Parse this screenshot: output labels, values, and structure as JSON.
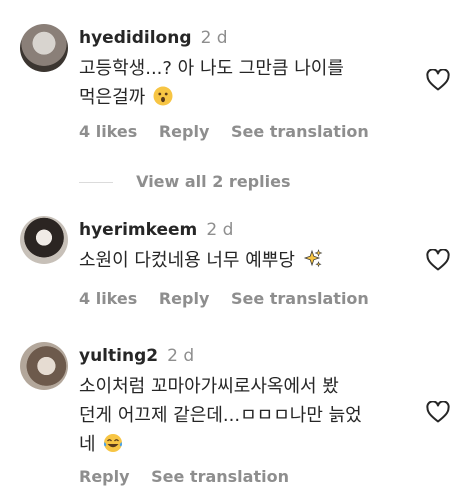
{
  "comments": [
    {
      "username": "hyedidilong",
      "time": "2 d",
      "text_line1": "고등학생...? 아 나도 그만큼 나이를",
      "text_line2": "먹은걸까",
      "likes": "4 likes",
      "reply": "Reply",
      "translate": "See translation",
      "emoji": "hushed-face-emoji"
    },
    {
      "username": "hyerimkeem",
      "time": "2 d",
      "text_line1": "소원이 다컸네용 너무 예뿌당",
      "likes": "4 likes",
      "reply": "Reply",
      "translate": "See translation",
      "emoji": "sparkles-emoji"
    },
    {
      "username": "yulting2",
      "time": "2 d",
      "text_line1": "소이처럼 꼬마아가씨로사옥에서 봤",
      "text_line2": "던게 어끄제 같은데...ㅁㅁㅁ나만 늙었",
      "text_line3": "네",
      "reply": "Reply",
      "translate": "See translation",
      "emoji": "tears-of-joy-emoji"
    }
  ],
  "view_replies": "View all 2 replies",
  "colors": {
    "text": "#262626",
    "muted": "#8e8e8e",
    "divider": "#dbdbdb",
    "emoji_yellow": "#f7c544"
  }
}
